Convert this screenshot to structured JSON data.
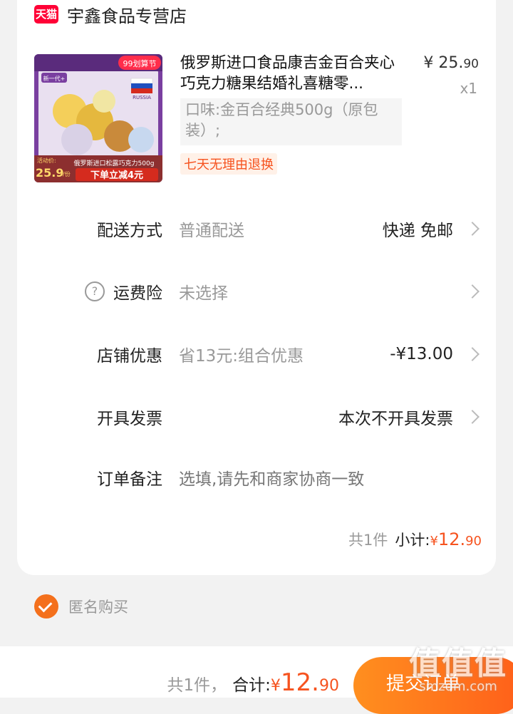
{
  "shop": {
    "badge": "天猫",
    "name": "宇鑫食品专营店"
  },
  "product": {
    "title": "俄罗斯进口食品康吉金百合夹心巧克力糖果结婚礼喜糖零...",
    "price_main": "¥ 25.",
    "price_decimal": "90",
    "quantity": "x1",
    "spec": "口味:金百合经典500g（原包装）;",
    "service_tag": "七天无理由退换",
    "image": {
      "top_badge": "99划算节",
      "left_badge": "新一代+",
      "country": "RUSSIA",
      "caption": "俄罗斯进口松露巧克力500g",
      "activity_label": "活动价:",
      "activity_price": "25.9",
      "activity_unit": "/份",
      "promo": "下单立减4元"
    }
  },
  "rows": {
    "delivery": {
      "label": "配送方式",
      "sub": "普通配送",
      "value": "快递 免邮"
    },
    "insurance": {
      "icon": "?",
      "label": "运费险",
      "sub": "未选择"
    },
    "discount": {
      "label": "店铺优惠",
      "sub": "省13元:组合优惠",
      "value": "-¥13.00"
    },
    "invoice": {
      "label": "开具发票",
      "value": "本次不开具发票"
    },
    "note": {
      "label": "订单备注",
      "placeholder": "选填,请先和商家协商一致"
    }
  },
  "subtotal": {
    "count": "共1件",
    "label": "小计:",
    "currency": "¥ ",
    "main": "12.",
    "decimal": "90"
  },
  "anonymous": {
    "label": "匿名购买",
    "checked": true
  },
  "footer": {
    "count": "共1件，",
    "label": "合计:",
    "currency": "¥ ",
    "main": "12.",
    "decimal": "90",
    "submit": "提交订单"
  },
  "watermark": {
    "title": "值值值",
    "url": "smzdm.com"
  },
  "colors": {
    "accent": "#f6531f",
    "brand_tmall": "#ff0036",
    "submit_start": "#ff8f1f",
    "submit_end": "#ff5f1a"
  }
}
